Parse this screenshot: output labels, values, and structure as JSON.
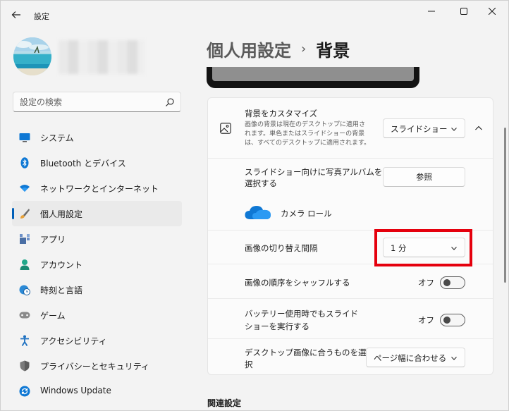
{
  "window": {
    "title": "設定",
    "controls": [
      "minimize",
      "maximize",
      "close"
    ]
  },
  "sidebar": {
    "search_placeholder": "設定の検索",
    "items": [
      {
        "label": "システム",
        "icon": "monitor-icon",
        "active": false
      },
      {
        "label": "Bluetooth とデバイス",
        "icon": "bluetooth-icon",
        "active": false
      },
      {
        "label": "ネットワークとインターネット",
        "icon": "wifi-icon",
        "active": false
      },
      {
        "label": "個人用設定",
        "icon": "brush-icon",
        "active": true
      },
      {
        "label": "アプリ",
        "icon": "apps-icon",
        "active": false
      },
      {
        "label": "アカウント",
        "icon": "person-icon",
        "active": false
      },
      {
        "label": "時刻と言語",
        "icon": "globe-clock-icon",
        "active": false
      },
      {
        "label": "ゲーム",
        "icon": "gamepad-icon",
        "active": false
      },
      {
        "label": "アクセシビリティ",
        "icon": "accessibility-icon",
        "active": false
      },
      {
        "label": "プライバシーとセキュリティ",
        "icon": "shield-icon",
        "active": false
      },
      {
        "label": "Windows Update",
        "icon": "update-icon",
        "active": false
      }
    ]
  },
  "main": {
    "breadcrumb_parent": "個人用設定",
    "breadcrumb_separator": "›",
    "breadcrumb_current": "背景",
    "customize": {
      "title": "背景をカスタマイズ",
      "desc_line1": "画像の背景は現在のデスクトップに適用さ",
      "desc_line2": "れます。単色またはスライドショーの背景",
      "desc_line3": "は、すべてのデスクトップに適用されます。",
      "dropdown_value": "スライドショー"
    },
    "album": {
      "label_line1": "スライドショー向けに写真アルバムを",
      "label_line2": "選択する",
      "browse_label": "参照",
      "folder_label": "カメラ ロール"
    },
    "interval": {
      "label": "画像の切り替え間隔",
      "value": "1 分"
    },
    "shuffle": {
      "label": "画像の順序をシャッフルする",
      "state": "オフ"
    },
    "battery": {
      "label_line1": "バッテリー使用時でもスライド",
      "label_line2": "ショーを実行する",
      "state": "オフ"
    },
    "fit": {
      "label_line1": "デスクトップ画像に合うものを選",
      "label_line2": "択",
      "value": "ページ幅に合わせる"
    },
    "related_title": "関連設定"
  },
  "colors": {
    "accent": "#005fb8",
    "highlight": "#e5000d",
    "onedrive": "#0f78d4"
  }
}
